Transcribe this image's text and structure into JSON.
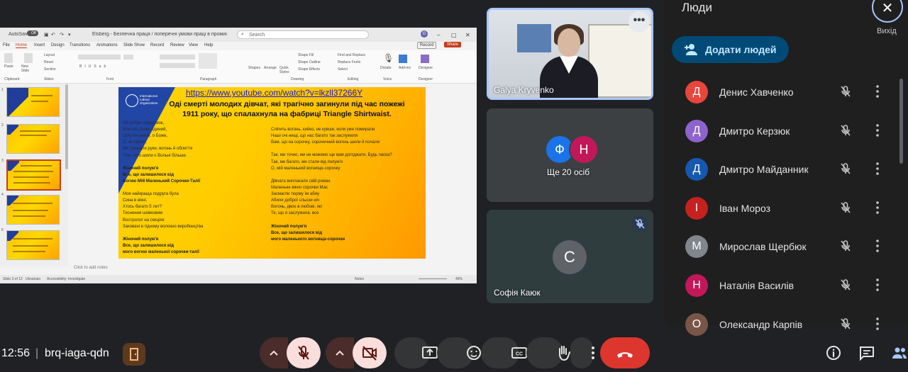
{
  "meeting": {
    "time": "12:56",
    "separator": "|",
    "code": "brq-iaga-qdn"
  },
  "presentation": {
    "titlebar": {
      "autosave": "AutoSave",
      "autosave_state": "Off",
      "doc_title": "Elsberg - Безпечна праця / поперечні умови праці в промисловості та рідкоземельних матеріалах (текст) ... • Saved to this PC",
      "search_placeholder": "Search",
      "user_initial": "G"
    },
    "tabs": [
      "File",
      "Home",
      "Insert",
      "Design",
      "Transitions",
      "Animations",
      "Slide Show",
      "Record",
      "Review",
      "View",
      "Help"
    ],
    "active_tab": "Home",
    "ribbon_right": [
      "Record",
      "Share"
    ],
    "ribbon_groups": [
      "Clipboard",
      "Slides",
      "Font",
      "Paragraph",
      "Drawing",
      "Editing",
      "Voice",
      "Designer"
    ],
    "ribbon_labels": {
      "paste": "Paste",
      "new_slide": "New Slide",
      "layout": "Layout",
      "reset": "Reset",
      "section": "Section",
      "shapes": "Shapes",
      "arrange": "Arrange",
      "quick_styles": "Quick Styles",
      "shape_fill": "Shape Fill",
      "shape_outline": "Shape Outline",
      "shape_effects": "Shape Effects",
      "find_replace": "Find and Replace",
      "replace_fonts": "Replace Fonts",
      "select": "Select",
      "dictate": "Dictate",
      "add_ins": "Add-ins",
      "designer": "Designer"
    },
    "slide": {
      "link": "https://www.youtube.com/watch?v=lkzll37266Y",
      "heading": "Оді смерті молодих дівчат, які трагічно загинули під час пожежі 1911 року, що спалахнула на фабриці Triangle Shirtwaist.",
      "logo_text": "International Labour Organization",
      "left_col": [
        "Ой добре серце моє,",
        "Всю ніч, Боже єдиний,",
        "Цілу ніч шили, о Боже,",
        "О, як сумно,",
        "Ми тримали руки, вогонь й облиття",
        "Тим, чого шили є Вольні більше.",
        "",
        "Жіночий полум'я",
        "Все, що залишилося від",
        "Вогню Мій Маленький Сорочки-Талії",
        "",
        "Моя найкраща подруга була",
        "Сина в вікні.",
        "Хтось багато 5 лет?",
        "Тиснення шовковим",
        "Востролог на секціях",
        "Заковані в гідному волокно виробництва",
        "",
        "Жіночий полум'я",
        "Все, що залишилося від",
        "мого вогню маленької сорочки-талії"
      ],
      "right_col": [
        "Сліпить вогонь, кийко, не кувши, коли уже помирали",
        "Наші очі нищі, що нас багато так заслужили",
        "Вам, що на сорочку, сорочечний вогонь шили й почали",
        "",
        "Так, ми точно, ми не можемо ще вам догоджати, Будь ласка?",
        "Так, ми багато, ми стали від полум'я",
        "О, мій маленький вогнище-сорочку",
        "",
        "Дівчата виплакали свій роман",
        "Маленьке вікно сорочки Має",
        "Засмагли тюрму їм абиу",
        "Абили доброї сльози ніч",
        "Вогонь, двоє в любові, які",
        "Те, що я заслужила, все",
        "",
        "Жіночий полум'я",
        "Все, що залишилося від",
        "мого маленького вогнища-сорочки"
      ]
    },
    "notes_placeholder": "Click to add notes",
    "status": {
      "slide_of": "Slide 3 of 12",
      "lang": "Ukrainian",
      "accessibility": "Accessibility: Investigate",
      "notes": "Notes",
      "zoom": "49%"
    },
    "thumbnail_numbers": [
      "1",
      "2",
      "3",
      "4",
      "5",
      "6",
      "7"
    ]
  },
  "tiles": {
    "presenter": {
      "name": "Galya Kryvenko",
      "more": "⋮"
    },
    "others": {
      "label": "Ще 20 осіб",
      "avatars": [
        {
          "letter": "Ф",
          "color": "#1a73e8"
        },
        {
          "letter": "Н",
          "color": "#c2185b"
        }
      ]
    },
    "sofia": {
      "name": "Софія Каюк",
      "letter": "С",
      "color": "#5f6368"
    }
  },
  "panel": {
    "title": "Люди",
    "close_label": "Вихід",
    "add_button": "Додати людей",
    "people": [
      {
        "letter": "Д",
        "name": "Денис Хавченко",
        "color": "#e8453c"
      },
      {
        "letter": "Д",
        "name": "Дмитро Керзюк",
        "color": "#8e63ce"
      },
      {
        "letter": "Д",
        "name": "Дмитро Майданник",
        "color": "#1558b0"
      },
      {
        "letter": "І",
        "name": "Іван Мороз",
        "color": "#c5221f"
      },
      {
        "letter": "М",
        "name": "Мирослав Щербюк",
        "color": "#80868b"
      },
      {
        "letter": "Н",
        "name": "Наталія Василів",
        "color": "#c2185b"
      },
      {
        "letter": "О",
        "name": "Олександр Карпів",
        "color": "#795548"
      }
    ]
  }
}
